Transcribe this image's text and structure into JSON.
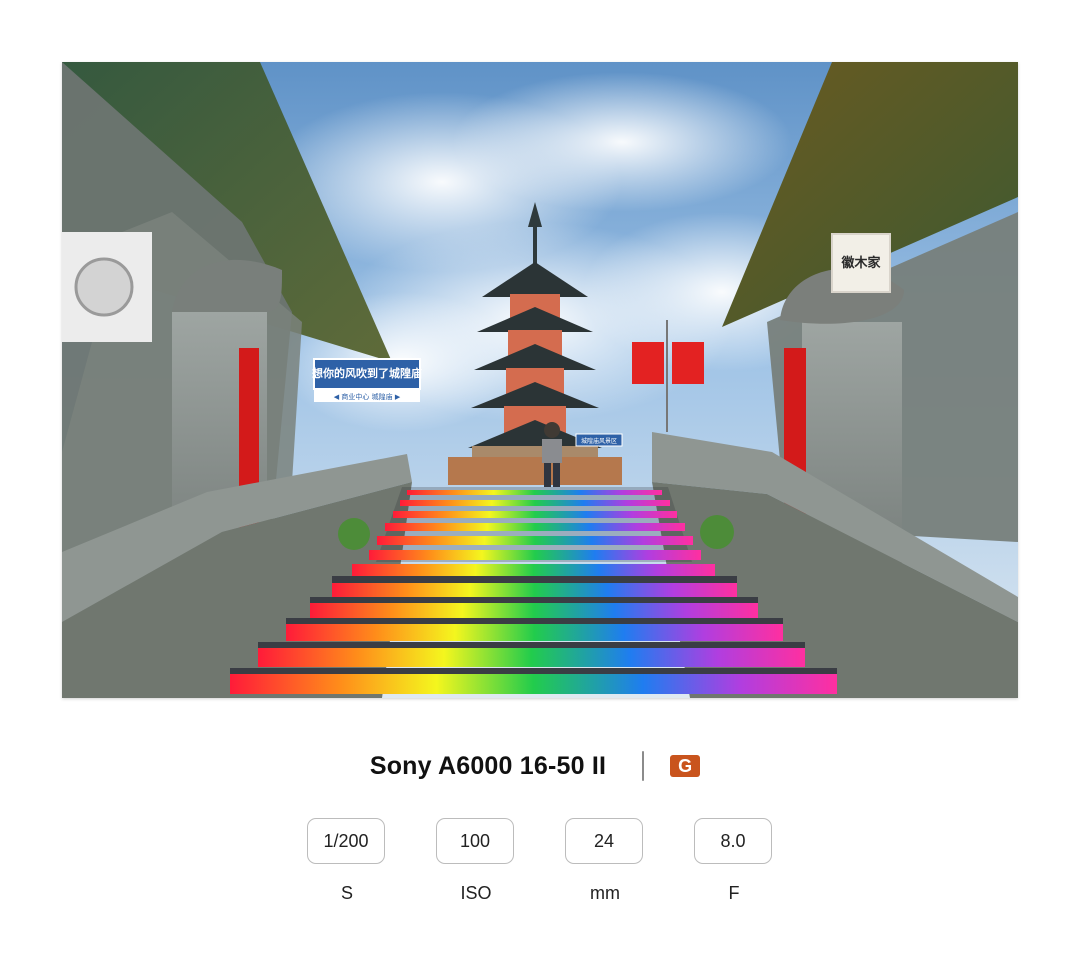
{
  "photo": {
    "signs": {
      "left_sign_main": "想你的风吹到了城隍庙",
      "left_sign_sub": "◀ 商业中心 城隍庙 ▶",
      "right_sign_main": "城隍庙风景区",
      "shop_sign": "徽木家"
    }
  },
  "camera": {
    "title": "Sony A6000 16-50 II",
    "badge_letter": "G",
    "badge_color": "#c9541d"
  },
  "exif": [
    {
      "value": "1/200",
      "label": "S"
    },
    {
      "value": "100",
      "label": "ISO"
    },
    {
      "value": "24",
      "label": "mm"
    },
    {
      "value": "8.0",
      "label": "F"
    }
  ]
}
